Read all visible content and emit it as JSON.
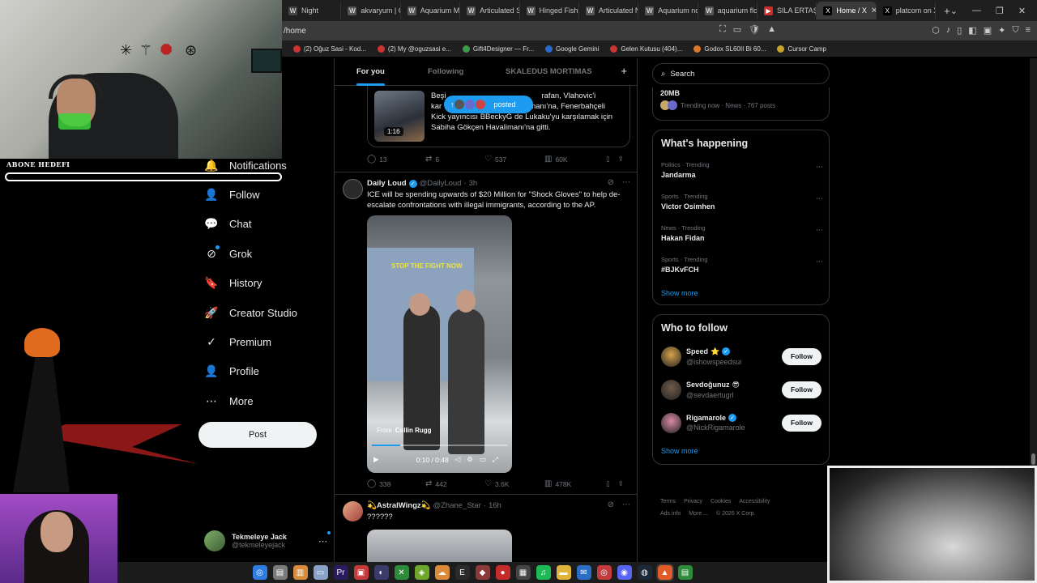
{
  "browser": {
    "tabs": [
      {
        "label": "Night",
        "icon": "W",
        "color": "#444444"
      },
      {
        "label": "akvaryum | C",
        "icon": "W",
        "color": "#555555"
      },
      {
        "label": "Aquarium M",
        "icon": "W",
        "color": "#555555"
      },
      {
        "label": "Articulated S",
        "icon": "W",
        "color": "#555555"
      },
      {
        "label": "Hinged Fishb",
        "icon": "W",
        "color": "#555555"
      },
      {
        "label": "Articulated N",
        "icon": "W",
        "color": "#555555"
      },
      {
        "label": "Aquarium no",
        "icon": "W",
        "color": "#555555"
      },
      {
        "label": "aquarium flo",
        "icon": "W",
        "color": "#555555"
      },
      {
        "label": "SILA ERTAŞ &",
        "icon": "▶",
        "color": "#cc2b2b"
      },
      {
        "label": "Home / X",
        "icon": "X",
        "color": "#000000",
        "active": true
      },
      {
        "label": "platcom on X",
        "icon": "X",
        "color": "#000000"
      }
    ],
    "new_tab": "+",
    "url": "/home",
    "bookmarks": [
      "(2) Oğuz Sasi - Kod...",
      "(2) My @oguzsasi e...",
      "Gift4Designer — Fr...",
      "Google Gemini",
      "Gelen Kutusu (404)...",
      "Godox SL60II Bi 60...",
      "Cursor Camp"
    ]
  },
  "overlay": {
    "goal_label": "ABONE HEDEFI",
    "goal_progress": 0
  },
  "nav": {
    "items": [
      {
        "label": "Notifications",
        "icon": "bell-icon",
        "glyph": "🔔"
      },
      {
        "label": "Follow",
        "icon": "follow-icon",
        "glyph": "👤"
      },
      {
        "label": "Chat",
        "icon": "chat-icon",
        "glyph": "💬"
      },
      {
        "label": "Grok",
        "icon": "grok-icon",
        "glyph": "⊘"
      },
      {
        "label": "History",
        "icon": "bookmark-icon",
        "glyph": "🔖"
      },
      {
        "label": "Creator Studio",
        "icon": "rocket-icon",
        "glyph": "🚀"
      },
      {
        "label": "Premium",
        "icon": "premium-icon",
        "glyph": "✓"
      },
      {
        "label": "Profile",
        "icon": "profile-icon",
        "glyph": "👤"
      },
      {
        "label": "More",
        "icon": "more-icon",
        "glyph": "⋯"
      }
    ],
    "post_label": "Post",
    "account": {
      "name": "Tekmeleye Jack",
      "handle": "@tekmeleyejack"
    }
  },
  "timeline": {
    "tabs": [
      "For you",
      "Following",
      "SKALEDUS MORTIMAS"
    ],
    "add_tab": "+",
    "quote": {
      "text": "Beşiktaş ... rafan, Vlahovic'i karşılamak için Sabiha Gökçen Havalimanı'na, Fenerbahçeli Kick yayıncısı BBeckyG de Lukaku'yu karşılamak için Sabiha Gökçen Havalimanı'na gitti.",
      "text_line1": "Beşi",
      "text_line1b": "rafan, Vlahovic'i",
      "text_line2a": "kar",
      "text_line2b": "imanı'na, Fenerbahçeli",
      "text_line3": "Kick yayıncısı BBeckyG de Lukaku'yu karşılamak için",
      "text_line4": "Sabiha Gökçen Havalimanı'na gitti.",
      "duration": "1:16",
      "stats": {
        "replies": "13",
        "reposts": "6",
        "likes": "537",
        "views": "60K"
      },
      "posted_label": "posted"
    },
    "post1": {
      "name": "Daily Loud",
      "handle": "@DailyLoud",
      "time": "3h",
      "text": "ICE will be spending upwards of $20 Million for \"Shock Gloves\" to help de-escalate confrontations with illegal immigrants, according to the AP.",
      "video_sign": "STOP THE FIGHT NOW",
      "from_label": "From",
      "from_name": "Collin Rugg",
      "video_time": "0:10 / 0:48",
      "video_progress": 0.21,
      "stats": {
        "replies": "338",
        "reposts": "442",
        "likes": "3.6K",
        "views": "478K"
      }
    },
    "post2": {
      "name": "💫AstralWingz💫",
      "handle": "@Zhane_Star",
      "time": "16h",
      "text": "??????"
    }
  },
  "right": {
    "search_placeholder": "Search",
    "top_trend": {
      "name": "20MB",
      "meta": "Trending now · News · 767 posts"
    },
    "happening": {
      "title": "What's happening",
      "trends": [
        {
          "category": "Politics · Trending",
          "name": "Jandarma"
        },
        {
          "category": "Sports · Trending",
          "name": "Victor Osimhen"
        },
        {
          "category": "News · Trending",
          "name": "Hakan Fidan"
        },
        {
          "category": "Sports · Trending",
          "name": "#BJKvFCH"
        }
      ],
      "show_more": "Show more"
    },
    "who_to_follow": {
      "title": "Who to follow",
      "accounts": [
        {
          "name": "Speed",
          "emoji": "⭐",
          "verified": true,
          "handle": "@ishowspeedsui",
          "color": "#d9a24a"
        },
        {
          "name": "Sevdoğunuz",
          "emoji": "😎",
          "verified": false,
          "handle": "@sevdaertugrl",
          "color": "#6f5a4a"
        },
        {
          "name": "Rigamarole",
          "emoji": "",
          "verified": true,
          "handle": "@NickRigamarole",
          "color": "#d98aa6"
        }
      ],
      "follow_label": "Follow",
      "show_more": "Show more"
    },
    "footer": {
      "links": [
        "Terms",
        "Privacy",
        "Cookies",
        "Accessibility",
        "Ads info",
        "More ...",
        "© 2026 X Corp."
      ]
    }
  },
  "taskbar": {
    "apps": [
      {
        "name": "chrome-icon",
        "glyph": "◎",
        "color": "#2f7de1"
      },
      {
        "name": "app-icon",
        "glyph": "▤",
        "color": "#7b7b7b"
      },
      {
        "name": "files-icon",
        "glyph": "▥",
        "color": "#d98b3a"
      },
      {
        "name": "window-icon",
        "glyph": "▭",
        "color": "#8aa2c8"
      },
      {
        "name": "premiere-icon",
        "glyph": "Pr",
        "color": "#2a1a5e"
      },
      {
        "name": "restream-icon",
        "glyph": "▣",
        "color": "#c43b3b"
      },
      {
        "name": "obs-icon",
        "glyph": "◐",
        "color": "#3b3b6b"
      },
      {
        "name": "xbox-icon",
        "glyph": "✕",
        "color": "#2e8b3a"
      },
      {
        "name": "nvidia-icon",
        "glyph": "◈",
        "color": "#6da82b"
      },
      {
        "name": "cloud-icon",
        "glyph": "☁",
        "color": "#d98b3a"
      },
      {
        "name": "epic-icon",
        "glyph": "E",
        "color": "#2a2a2a"
      },
      {
        "name": "game-icon",
        "glyph": "◆",
        "color": "#8a3a3a"
      },
      {
        "name": "record-icon",
        "glyph": "●",
        "color": "#c42b2b"
      },
      {
        "name": "clapper-icon",
        "glyph": "▦",
        "color": "#444"
      },
      {
        "name": "spotify-icon",
        "glyph": "♫",
        "color": "#1db954"
      },
      {
        "name": "folder-icon",
        "glyph": "▬",
        "color": "#e0b43a"
      },
      {
        "name": "mail-icon",
        "glyph": "✉",
        "color": "#2b6cc4"
      },
      {
        "name": "chrome-alt-icon",
        "glyph": "◎",
        "color": "#c43b3b"
      },
      {
        "name": "discord-icon",
        "glyph": "◉",
        "color": "#5865f2"
      },
      {
        "name": "steam-icon",
        "glyph": "◍",
        "color": "#1b2838"
      },
      {
        "name": "brave-icon",
        "glyph": "▲",
        "color": "#e25c2a",
        "active": true
      },
      {
        "name": "notes-icon",
        "glyph": "▤",
        "color": "#2e8b3a"
      }
    ]
  }
}
